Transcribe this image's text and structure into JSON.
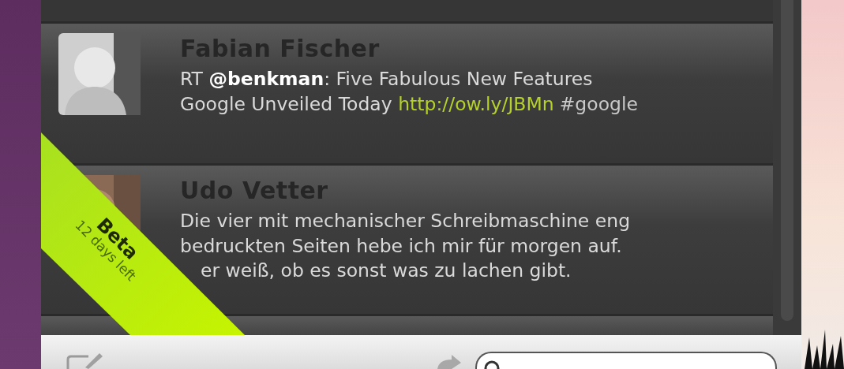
{
  "tweets": [
    {
      "kind": "full",
      "name": "Fabian Fischer",
      "lines": [
        [
          {
            "kind": "plain",
            "text": "RT "
          },
          {
            "kind": "mention",
            "text": "@benkman"
          },
          {
            "kind": "plain",
            "text": ": Five Fabulous New Features"
          }
        ],
        [
          {
            "kind": "plain",
            "text": "Google Unveiled Today "
          },
          {
            "kind": "link",
            "text": "http://ow.ly/JBMn"
          },
          {
            "kind": "hashtag",
            "text": "#google"
          }
        ]
      ]
    },
    {
      "kind": "full",
      "name": "Udo Vetter",
      "lines": [
        [
          {
            "kind": "plain",
            "text": "Die vier mit mechanischer Schreibmaschine eng"
          }
        ],
        [
          {
            "kind": "plain",
            "text": "bedruckten Seiten hebe ich mir für morgen auf."
          }
        ],
        [
          {
            "kind": "covered",
            "text": "er weiß, ob es sonst was zu lachen gibt."
          }
        ]
      ]
    }
  ],
  "badge": {
    "title": "Beta",
    "subtitle": "12 days left"
  }
}
